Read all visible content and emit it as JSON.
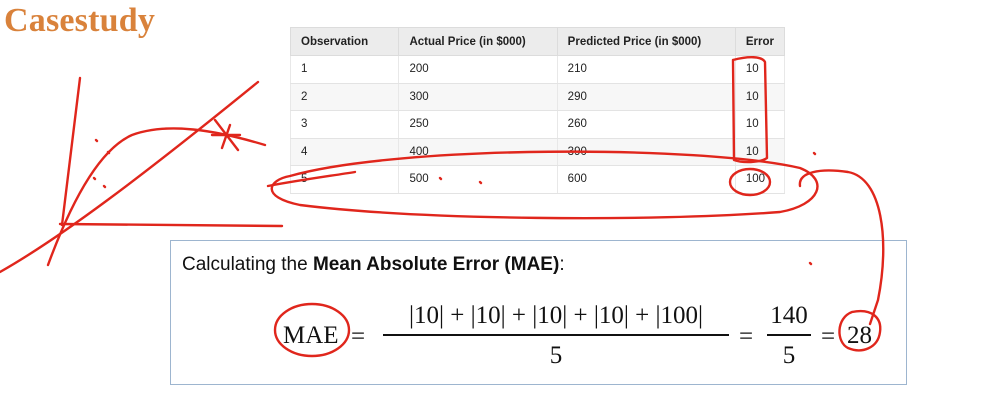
{
  "title": "Casestudy",
  "table": {
    "headers": [
      "Observation",
      "Actual Price (in $000)",
      "Predicted Price (in $000)",
      "Error"
    ],
    "rows": [
      [
        "1",
        "200",
        "210",
        "10"
      ],
      [
        "2",
        "300",
        "290",
        "10"
      ],
      [
        "3",
        "250",
        "260",
        "10"
      ],
      [
        "4",
        "400",
        "390",
        "10"
      ],
      [
        "5",
        "500",
        "600",
        "100"
      ]
    ]
  },
  "mae": {
    "intro_prefix": "Calculating the",
    "intro_bold": "Mean Absolute Error (MAE)",
    "intro_suffix": ":",
    "lhs": "MAE",
    "equals": "=",
    "numerator": "|10| + |10| + |10| + |10| + |100|",
    "denominator": "5",
    "num2": "140",
    "den2": "5",
    "result": "28"
  },
  "annotation_color": "#e0261c"
}
